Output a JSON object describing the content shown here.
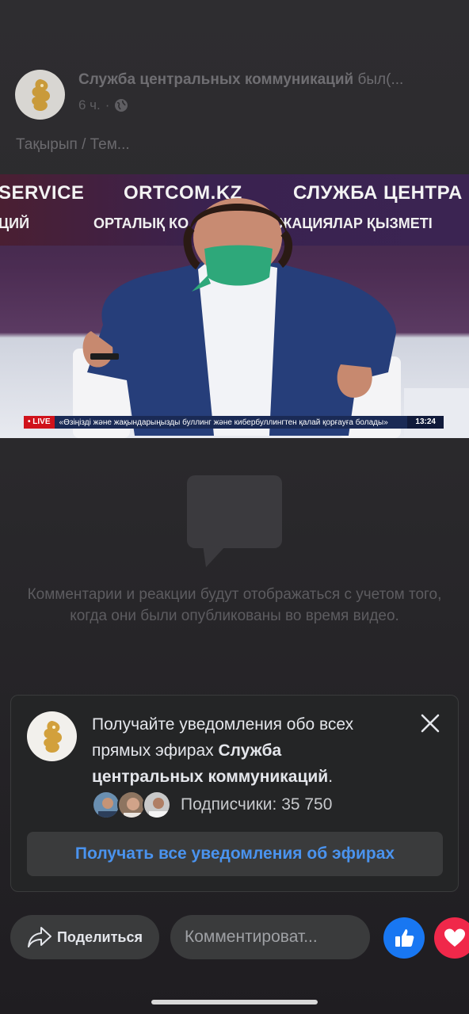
{
  "post": {
    "page_name": "Служба центральных коммуникаций",
    "page_name_suffix": " был(...",
    "time": "6 ч.",
    "dot": "·",
    "privacy_icon": "globe-icon",
    "topic": "Тақырып / Тем..."
  },
  "video": {
    "banner_left": "SERVICE",
    "banner_center": "ORTCOM.KZ",
    "banner_right": "СЛУЖБА ЦЕНТРА",
    "banner_row2_left": "ЦИЙ",
    "banner_row2_center": "ОРТАЛЫҚ КО",
    "banner_row2_right": "ЖАЦИЯЛАР ҚЫЗМЕТІ",
    "live_badge": "• LIVE",
    "ticker_text": "«Өзіңізді және жақындарыңызды буллинг және кибербуллингтен қалай қорғауға болады»",
    "ticker_time": "13:24"
  },
  "comments": {
    "icon": "comment-bubble-icon",
    "info_text": "Комментарии и реакции будут отображаться с учетом того, когда они были опубликованы во время видео."
  },
  "notification": {
    "text_before": "Получайте уведомления обо всех прямых эфирах ",
    "text_bold": "Служба центральных коммуникаций",
    "text_after": ".",
    "followers_label": "Подписчики: 35 750",
    "button_label": "Получать все уведомления об эфирах",
    "close_icon": "close-icon"
  },
  "bottom_bar": {
    "share_label": "Поделиться",
    "comment_placeholder": "Комментироват...",
    "like_icon": "thumbs-up-icon",
    "love_icon": "heart-icon"
  },
  "colors": {
    "link_blue": "#4a93ee",
    "like_blue": "#1877f2",
    "love_red": "#f0284a",
    "card_bg": "#242526"
  }
}
